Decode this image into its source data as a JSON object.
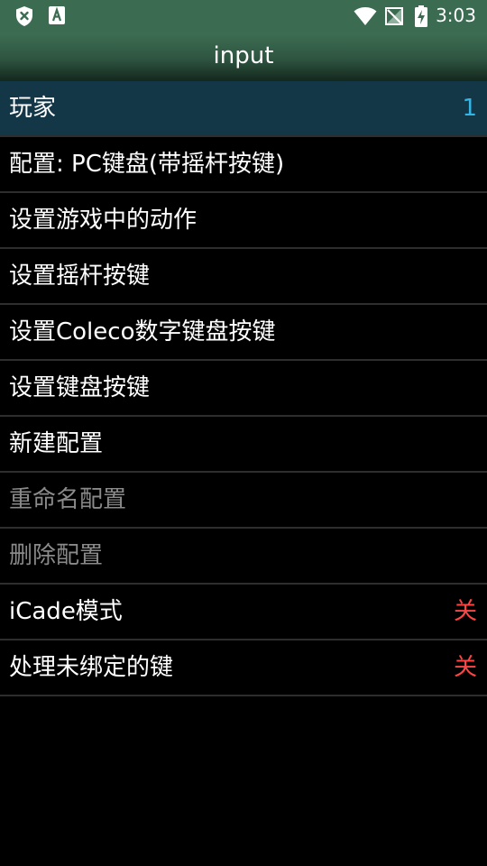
{
  "status_bar": {
    "time": "3:03",
    "icons": [
      "shield-x-icon",
      "text-a-icon",
      "wifi-icon",
      "no-signal-icon",
      "battery-charging-icon"
    ]
  },
  "app_bar": {
    "title": "input"
  },
  "menu": {
    "items": [
      {
        "label": "玩家",
        "value": "1",
        "value_color": "#33b5e5",
        "selected": true,
        "enabled": true
      },
      {
        "label": "配置: PC键盘(带摇杆按键)",
        "value": "",
        "enabled": true
      },
      {
        "label": "设置游戏中的动作",
        "value": "",
        "enabled": true
      },
      {
        "label": "设置摇杆按键",
        "value": "",
        "enabled": true
      },
      {
        "label": "设置Coleco数字键盘按键",
        "value": "",
        "enabled": true
      },
      {
        "label": "设置键盘按键",
        "value": "",
        "enabled": true
      },
      {
        "label": "新建配置",
        "value": "",
        "enabled": true
      },
      {
        "label": "重命名配置",
        "value": "",
        "enabled": false
      },
      {
        "label": "删除配置",
        "value": "",
        "enabled": false
      },
      {
        "label": "iCade模式",
        "value": "关",
        "value_color": "#ff4444",
        "enabled": true
      },
      {
        "label": "处理未绑定的键",
        "value": "关",
        "value_color": "#ff4444",
        "enabled": true
      }
    ]
  },
  "colors": {
    "status_bar": "#3b6b51",
    "selected_row": "#133747",
    "divider": "#2e2e2e",
    "disabled_text": "#8a8a8a"
  }
}
